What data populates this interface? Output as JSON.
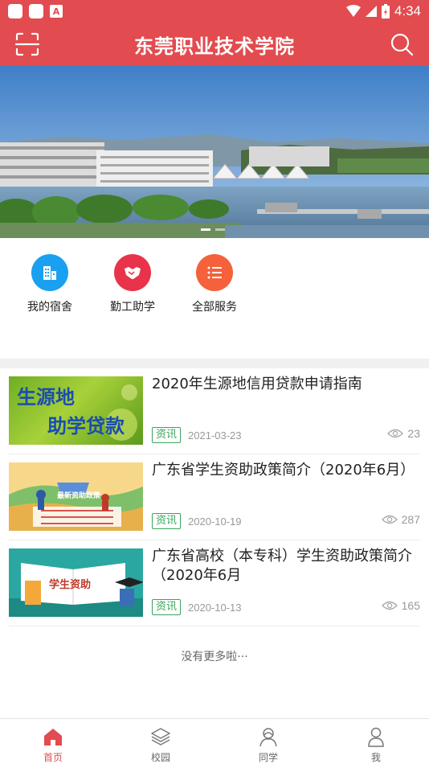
{
  "status_bar": {
    "time": "4:34"
  },
  "header": {
    "title": "东莞职业技术学院"
  },
  "services": [
    {
      "label": "我的宿舍",
      "icon": "building-icon",
      "color": "#1aa0f0"
    },
    {
      "label": "勤工助学",
      "icon": "handshake-icon",
      "color": "#e8334a"
    },
    {
      "label": "全部服务",
      "icon": "list-icon",
      "color": "#f4613a"
    }
  ],
  "news": [
    {
      "title": "2020年生源地信用贷款申请指南",
      "tag": "资讯",
      "date": "2021-03-23",
      "views": "23",
      "thumb_text_1": "生源地",
      "thumb_text_2": "助学贷款"
    },
    {
      "title": "广东省学生资助政策简介（2020年6月）",
      "tag": "资讯",
      "date": "2020-10-19",
      "views": "287",
      "thumb_text": "最新资助政策"
    },
    {
      "title": "广东省高校（本专科）学生资助政策简介（2020年6月",
      "tag": "资讯",
      "date": "2020-10-13",
      "views": "165",
      "thumb_text": "学生资助"
    }
  ],
  "footer_text": "没有更多啦···",
  "tabs": [
    {
      "label": "首页",
      "icon": "home-icon"
    },
    {
      "label": "校园",
      "icon": "layers-icon"
    },
    {
      "label": "同学",
      "icon": "classmates-icon"
    },
    {
      "label": "我",
      "icon": "person-icon"
    }
  ],
  "colors": {
    "brand": "#e24b4f",
    "tag_green": "#3aa55c"
  }
}
